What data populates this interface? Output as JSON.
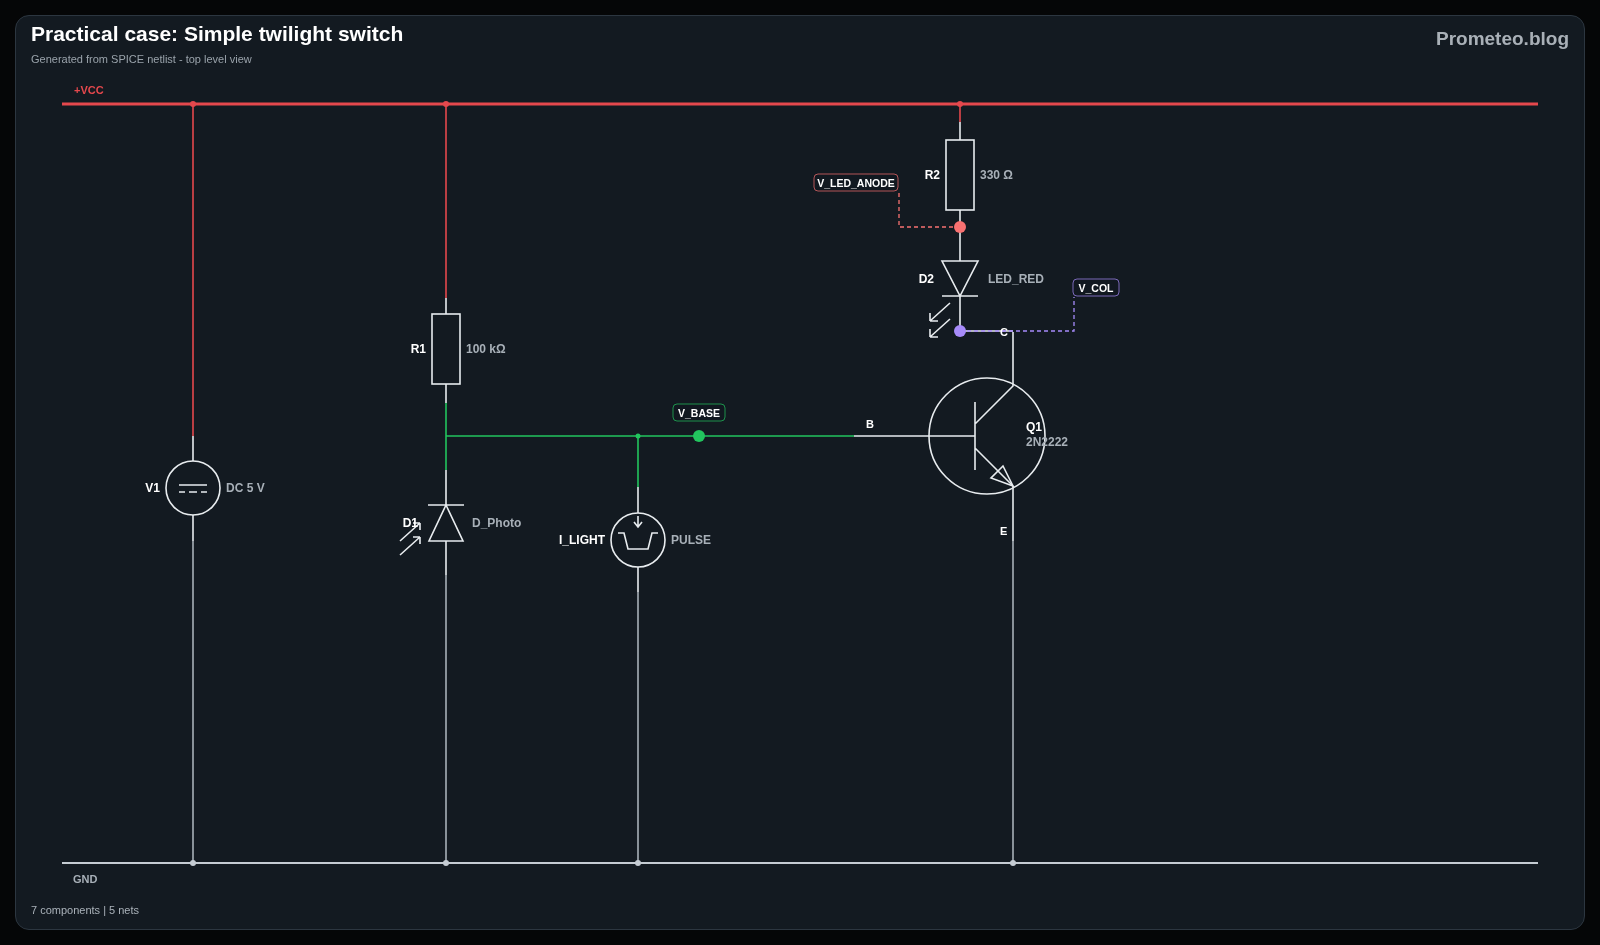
{
  "header": {
    "title": "Practical case: Simple twilight switch",
    "subtitle": "Generated from SPICE netlist - top level view",
    "brand": "Prometeo.blog"
  },
  "rails": [
    {
      "kind": "supply",
      "label": "+VCC"
    },
    {
      "kind": "ground",
      "label": "GND"
    }
  ],
  "components": [
    {
      "kind": "voltage-source",
      "ref": "V1",
      "value": "DC 5 V"
    },
    {
      "kind": "resistor",
      "ref": "R1",
      "value": "100 kΩ"
    },
    {
      "kind": "photodiode",
      "ref": "D1",
      "value": "D_Photo"
    },
    {
      "kind": "current-source",
      "ref": "I_LIGHT",
      "value": "PULSE"
    },
    {
      "kind": "resistor",
      "ref": "R2",
      "value": "330 Ω"
    },
    {
      "kind": "led",
      "ref": "D2",
      "value": "LED_RED"
    },
    {
      "kind": "npn",
      "ref": "Q1",
      "value": "2N2222",
      "pins": [
        "B",
        "C",
        "E"
      ]
    }
  ],
  "net_labels": [
    {
      "kind": "base",
      "label": "V_BASE",
      "color": "#22c55e"
    },
    {
      "kind": "anode",
      "label": "V_LED_ANODE",
      "color": "#f87171"
    },
    {
      "kind": "collector",
      "label": "V_COL",
      "color": "#a78bfa"
    }
  ],
  "footer": "7 components | 5 nets"
}
